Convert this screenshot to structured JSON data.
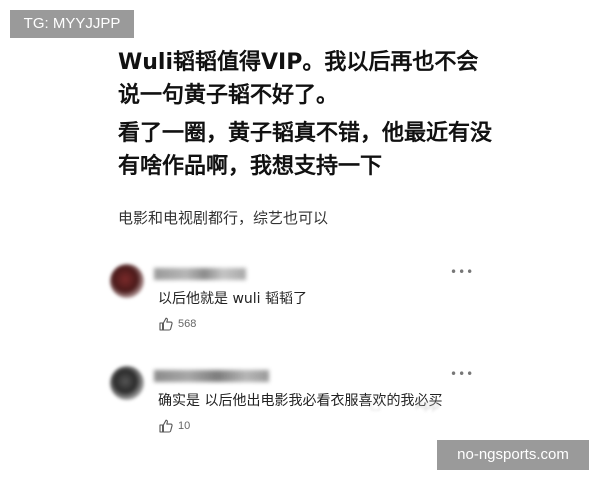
{
  "watermarks": {
    "top_left": "TG: MYYJJPP",
    "bottom_right": "no-ngsports.com"
  },
  "post": {
    "title": "Wuli韬韬值得VIP。我以后再也不会说一句黄子韬不好了。",
    "body": "看了一圈，黄子韬真不错，他最近有没有啥作品啊，我想支持一下",
    "subtext": "电影和电视剧都行，综艺也可以"
  },
  "comments": [
    {
      "text": "以后他就是 wuli 韬韬了",
      "likes": "568",
      "avatar_icon": "user-avatar",
      "like_icon": "thumbs-up-icon",
      "more_icon": "more-icon"
    },
    {
      "text": "确实是 以后他出电影我必看衣服喜欢的我必买",
      "likes": "10",
      "avatar_icon": "user-avatar",
      "like_icon": "thumbs-up-icon",
      "more_icon": "more-icon"
    }
  ],
  "colors": {
    "watermark_bg": "#9a9a9a",
    "text_dark": "#111111",
    "text_muted": "#666666"
  }
}
